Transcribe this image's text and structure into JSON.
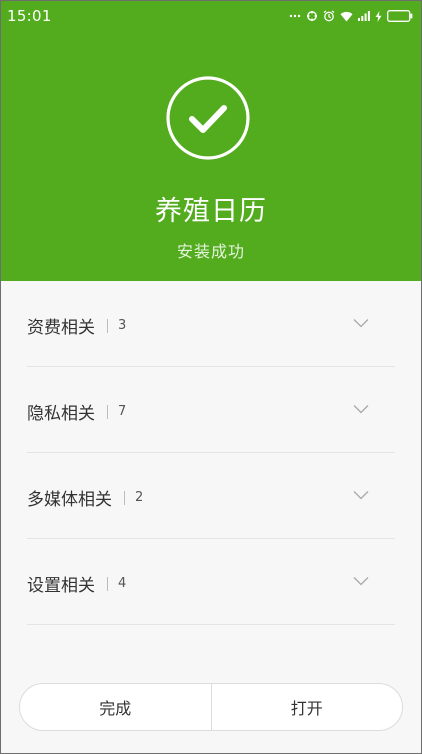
{
  "status_bar": {
    "time": "15:01",
    "icons": [
      "dots-icon",
      "sync-icon",
      "alarm-icon",
      "wifi-icon",
      "signal-icon",
      "charging-icon",
      "battery-icon"
    ]
  },
  "header": {
    "app_name": "养殖日历",
    "status_text": "安装成功",
    "background_color": "#52ac1e",
    "icon": "check-circle-icon"
  },
  "permissions": [
    {
      "label": "资费相关",
      "count": "3"
    },
    {
      "label": "隐私相关",
      "count": "7"
    },
    {
      "label": "多媒体相关",
      "count": "2"
    },
    {
      "label": "设置相关",
      "count": "4"
    }
  ],
  "buttons": {
    "done_label": "完成",
    "open_label": "打开"
  }
}
